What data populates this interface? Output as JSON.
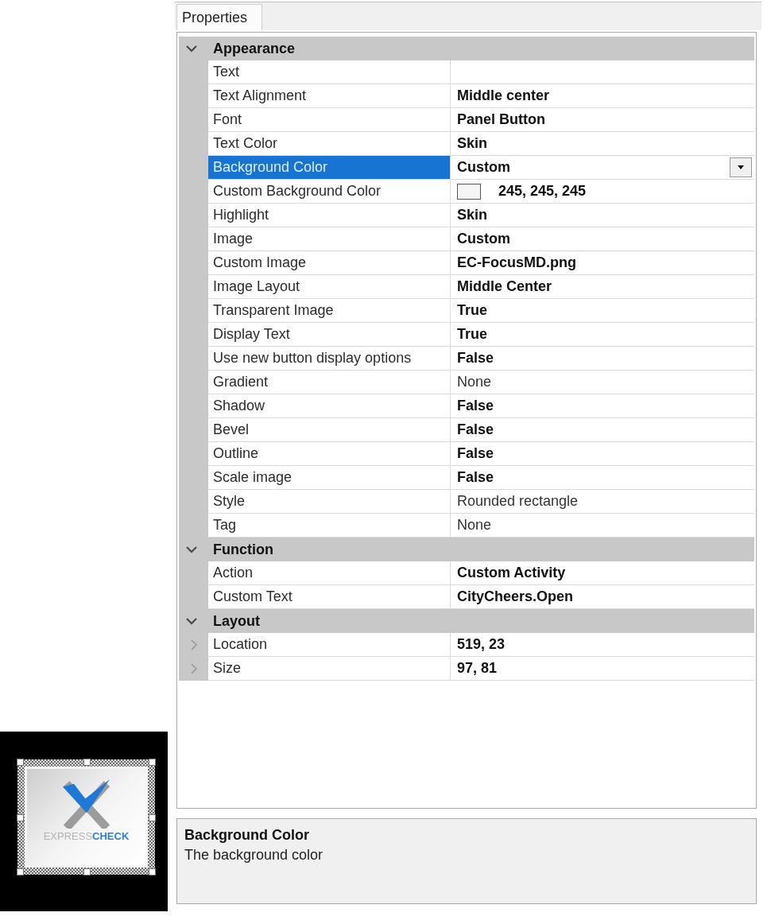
{
  "canvas": {
    "button": {
      "wordmark": [
        "EXPRESS",
        "CHECK"
      ]
    }
  },
  "tabs": [
    {
      "label": "Properties",
      "selected": true
    }
  ],
  "categories": [
    {
      "name": "Appearance",
      "expanded": true,
      "properties": [
        {
          "name": "Text",
          "kind": "text",
          "selected": false
        },
        {
          "name": "Text Alignment",
          "value": "Middle center",
          "kind": "text",
          "modified": true,
          "selected": false
        },
        {
          "name": "Font",
          "value": "Panel Button",
          "kind": "text",
          "modified": true,
          "selected": false
        },
        {
          "name": "Text Color",
          "value": "Skin",
          "kind": "text",
          "modified": true,
          "selected": false
        },
        {
          "name": "Background Color",
          "value": "Custom",
          "kind": "text",
          "modified": true,
          "selected": true
        },
        {
          "name": "Custom Background Color",
          "value": "245, 245, 245",
          "kind": "color",
          "color": "#f5f5f5",
          "modified": true,
          "selected": false
        },
        {
          "name": "Highlight",
          "value": "Skin",
          "kind": "text",
          "modified": true,
          "selected": false
        },
        {
          "name": "Image",
          "value": "Custom",
          "kind": "text",
          "modified": true,
          "selected": false
        },
        {
          "name": "Custom Image",
          "value": "EC-FocusMD.png",
          "kind": "text",
          "modified": true,
          "selected": false
        },
        {
          "name": "Image Layout",
          "value": "Middle Center",
          "kind": "text",
          "modified": true,
          "selected": false
        },
        {
          "name": "Transparent Image",
          "value": "True",
          "kind": "text",
          "modified": true,
          "selected": false
        },
        {
          "name": "Display Text",
          "value": "True",
          "kind": "text",
          "modified": true,
          "selected": false
        },
        {
          "name": "Use new button display options",
          "value": "False",
          "kind": "text",
          "modified": true,
          "selected": false
        },
        {
          "name": "Gradient",
          "value": "None",
          "kind": "text",
          "modified": false,
          "selected": false
        },
        {
          "name": "Shadow",
          "value": "False",
          "kind": "text",
          "modified": true,
          "selected": false
        },
        {
          "name": "Bevel",
          "value": "False",
          "kind": "text",
          "modified": true,
          "selected": false
        },
        {
          "name": "Outline",
          "value": "False",
          "kind": "text",
          "modified": true,
          "selected": false
        },
        {
          "name": "Scale image",
          "value": "False",
          "kind": "text",
          "modified": true,
          "selected": false
        },
        {
          "name": "Style",
          "value": "Rounded rectangle",
          "kind": "text",
          "modified": false,
          "selected": false
        },
        {
          "name": "Tag",
          "value": "None",
          "kind": "text",
          "modified": false,
          "selected": false
        }
      ]
    },
    {
      "name": "Function",
      "expanded": true,
      "properties": [
        {
          "name": "Action",
          "value": "Custom Activity",
          "kind": "text",
          "modified": true,
          "selected": false
        },
        {
          "name": "Custom Text",
          "value": "CityCheers.Open",
          "kind": "text",
          "modified": true,
          "selected": false
        }
      ]
    },
    {
      "name": "Layout",
      "expanded": true,
      "properties": [
        {
          "name": "Location",
          "value": "519, 23",
          "kind": "composite",
          "expanded": false,
          "modified": true,
          "selected": false
        },
        {
          "name": "Size",
          "value": "97, 81",
          "kind": "composite",
          "expanded": false,
          "modified": true,
          "selected": false
        }
      ]
    }
  ],
  "description": {
    "title": "Background Color",
    "text": "The background color"
  }
}
